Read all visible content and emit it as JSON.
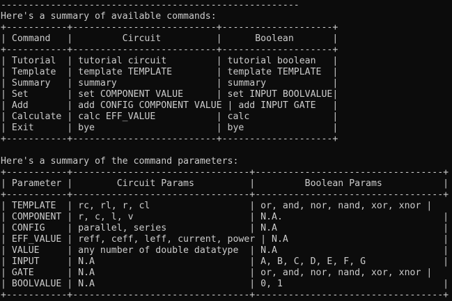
{
  "terminal": {
    "lines": [
      "------------------------------------------------------",
      "Here's a summary of available commands:",
      "+-----------+--------------------------+--------------------+",
      "| Command   |         Circuit          |      Boolean       |",
      "+-----------+--------------------------+--------------------+",
      "| Tutorial  | tutorial circuit         | tutorial boolean   |",
      "| Template  | template TEMPLATE        | template TEMPLATE  |",
      "| Summary   | summary                  | summary            |",
      "| Set       | set COMPONENT VALUE      | set INPUT BOOLVALUE|",
      "| Add       | add CONFIG COMPONENT VALUE | add INPUT GATE   |",
      "| Calculate | calc EFF_VALUE           | calc               |",
      "| Exit      | bye                      | bye                |",
      "+-----------+--------------------------+--------------------+",
      "",
      "Here's a summary of the command parameters:",
      "+-----------+--------------------------------+----------------------------------+",
      "| Parameter |        Circuit Params          |         Boolean Params           |",
      "+-----------+--------------------------------+----------------------------------+",
      "| TEMPLATE  | rc, rl, r, cl                  | or, and, nor, nand, xor, xnor |",
      "| COMPONENT | r, c, l, v                     | N.A.                             |",
      "| CONFIG    | parallel, series               | N.A                              |",
      "| EFF_VALUE | reff, ceff, leff, current, power | N.A                            |",
      "| VALUE     | any number of double datatype  | N.A                              |",
      "| INPUT     | N.A                            | A, B, C, D, E, F, G              |",
      "| GATE      | N.A                            | or, and, nor, nand, xor, xnor |",
      "| BOOLVALUE | N.A                            | 0, 1                             |",
      "+-----------+--------------------------------+----------------------------------+"
    ]
  }
}
